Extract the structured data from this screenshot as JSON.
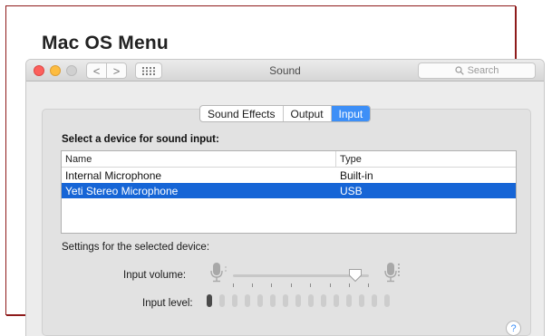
{
  "frame": {
    "title": "Mac OS Menu"
  },
  "window": {
    "title": "Sound",
    "nav": {
      "back_glyph": "<",
      "forward_glyph": ">"
    },
    "search_placeholder": "Search"
  },
  "tabs": [
    {
      "label": "Sound Effects",
      "active": false
    },
    {
      "label": "Output",
      "active": false
    },
    {
      "label": "Input",
      "active": true
    }
  ],
  "input": {
    "heading": "Select a device for sound input:",
    "columns": {
      "name": "Name",
      "type": "Type"
    },
    "devices": [
      {
        "name": "Internal Microphone",
        "type": "Built-in",
        "selected": false
      },
      {
        "name": "Yeti Stereo Microphone",
        "type": "USB",
        "selected": true
      }
    ],
    "settings_label": "Settings for the selected device:",
    "volume_label": "Input volume:",
    "volume_fraction": 0.9,
    "level_label": "Input level:",
    "level_bars_total": 15,
    "level_bars_active": 1
  },
  "help_glyph": "?",
  "colors": {
    "accent": "#3d8ff7",
    "selection": "#1665d6",
    "frame_border": "#8e1b1b"
  },
  "icons": [
    "search-icon",
    "microphone-icon",
    "grid-icon",
    "help-icon"
  ]
}
